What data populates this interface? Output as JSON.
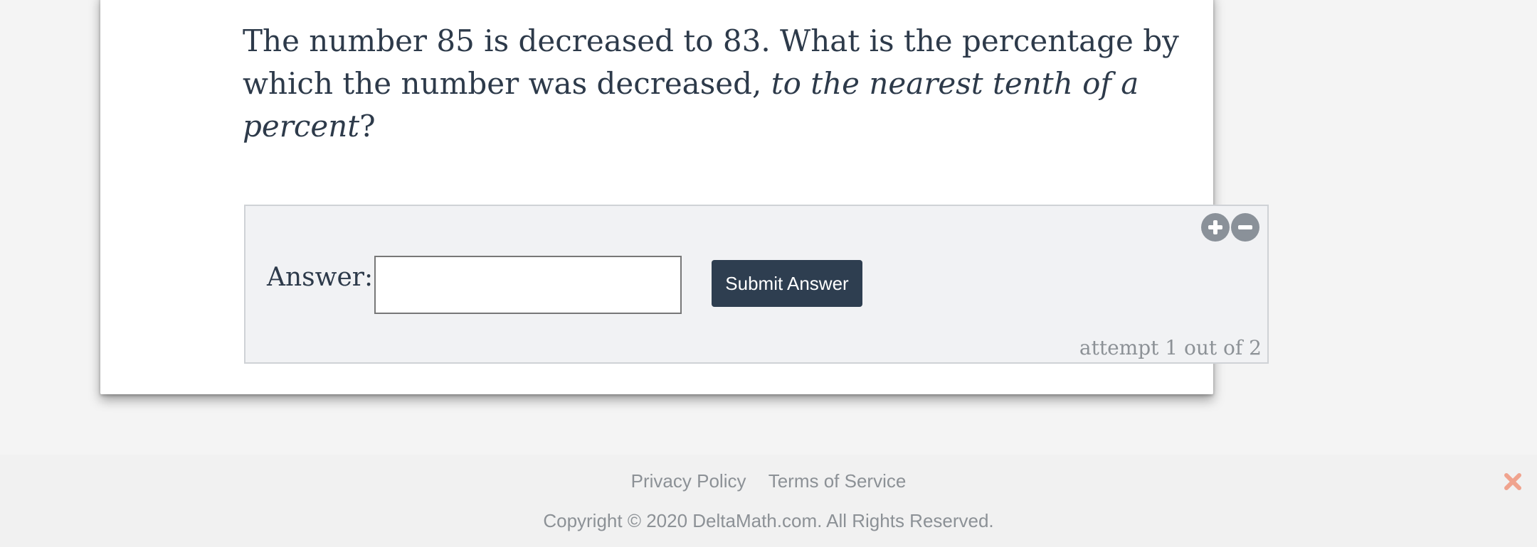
{
  "question": {
    "text_plain": "The number 85 is decreased to 83. What is the percentage by which the number was decreased, ",
    "text_italic": "to the nearest tenth of a percent",
    "text_end": "?"
  },
  "answer_panel": {
    "label": "Answer:",
    "input_value": "",
    "input_placeholder": "",
    "submit_label": "Submit Answer",
    "attempt_text": "attempt 1 out of 2",
    "zoom_in_icon": "plus-circle-icon",
    "zoom_out_icon": "minus-circle-icon"
  },
  "footer": {
    "privacy_label": "Privacy Policy",
    "terms_label": "Terms of Service",
    "copyright": "Copyright © 2020 DeltaMath.com. All Rights Reserved.",
    "close_icon": "close-icon"
  },
  "colors": {
    "button_dark": "#2e3e50",
    "text_primary": "#2d3a4a",
    "text_muted": "#8c9196",
    "close_accent": "#f0a38e",
    "panel_bg": "#f1f2f4"
  }
}
